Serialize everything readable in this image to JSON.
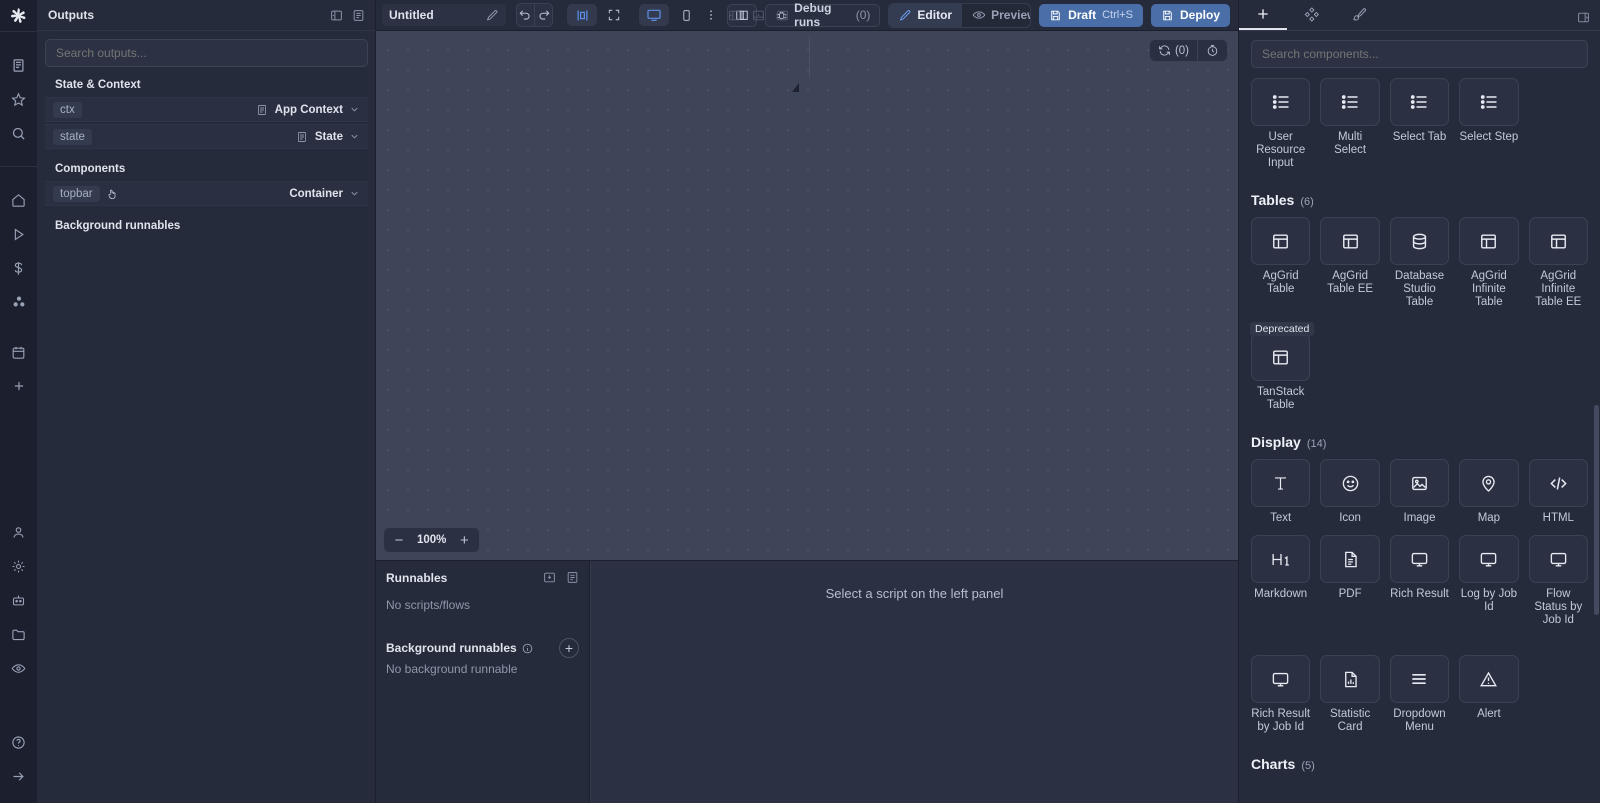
{
  "rail": {
    "logo": "windmill-logo",
    "groups": [
      [
        {
          "name": "runs-icon",
          "label": "Runs"
        },
        {
          "name": "star-icon",
          "label": "Favorites"
        },
        {
          "name": "search-icon",
          "label": "Search"
        }
      ],
      [
        {
          "name": "home-icon",
          "label": "Home"
        },
        {
          "name": "play-icon",
          "label": "Runs"
        },
        {
          "name": "dollar-icon",
          "label": "Usage"
        },
        {
          "name": "variables-icon",
          "label": "Resources"
        }
      ],
      [
        {
          "name": "calendar-icon",
          "label": "Schedules"
        },
        {
          "name": "plus-icon",
          "label": "New"
        }
      ],
      [
        {
          "name": "user-icon",
          "label": "Account"
        },
        {
          "name": "gear-icon",
          "label": "Settings"
        },
        {
          "name": "worker-icon",
          "label": "Workers"
        },
        {
          "name": "folder-icon",
          "label": "Folders"
        },
        {
          "name": "eye-icon",
          "label": "Audit logs"
        }
      ],
      [
        {
          "name": "help-icon",
          "label": "Help"
        },
        {
          "name": "arrow-right-icon",
          "label": "Expand"
        }
      ]
    ]
  },
  "topbar": {
    "app_title": "Untitled",
    "edit_icon": "pencil-icon",
    "undo_label": "undo-icon",
    "redo_label": "redo-icon",
    "center_align_icon": "align-center-icon",
    "fullscreen_icon": "fullscreen-icon",
    "desktop_icon": "desktop-icon",
    "mobile_icon": "mobile-icon",
    "panel_left_icon": "panel-left-icon",
    "panel_bottom_icon": "panel-bottom-icon",
    "panel_right_icon": "panel-right-icon",
    "more_icon": "more-vertical-icon",
    "book_icon": "book-icon",
    "debug_runs_label": "Debug runs",
    "debug_runs_count": "(0)",
    "editor_label": "Editor",
    "preview_label": "Preview",
    "draft_label": "Draft",
    "draft_shortcut": "Ctrl+S",
    "deploy_label": "Deploy"
  },
  "outputs_panel": {
    "title": "Outputs",
    "collapse_icon": "panel-collapse-icon",
    "list_icon": "list-icon",
    "search_placeholder": "Search outputs...",
    "sections": [
      {
        "label": "State & Context",
        "rows": [
          {
            "id": "ctx",
            "type": "App Context",
            "icon": "document-icon",
            "caret": "chevron-down-icon"
          },
          {
            "id": "state",
            "type": "State",
            "icon": "document-icon",
            "caret": "chevron-down-icon"
          }
        ]
      },
      {
        "label": "Components",
        "rows": [
          {
            "id": "topbar",
            "type": "Container",
            "icon": "",
            "caret": "chevron-down-icon",
            "cursor": "hand-pointer-icon"
          }
        ]
      }
    ],
    "background_runnables_label": "Background runnables"
  },
  "canvas": {
    "refresh_icon": "refresh-icon",
    "refresh_count": "(0)",
    "history_icon": "history-icon",
    "zoom_minus": "−",
    "zoom_value": "100%",
    "zoom_plus": "+"
  },
  "runnables_panel": {
    "title": "Runnables",
    "icon_1": "insert-icon",
    "icon_2": "list-icon",
    "empty_text": "No scripts/flows",
    "background_title": "Background runnables",
    "info_icon": "info-icon",
    "add_icon": "plus-icon",
    "background_empty": "No background runnable"
  },
  "script_pane": {
    "placeholder": "Select a script on the left panel"
  },
  "components_panel": {
    "tabs": [
      {
        "name": "tab-add",
        "icon": "plus-icon",
        "active": true
      },
      {
        "name": "tab-components",
        "icon": "grid-dots-icon",
        "active": false
      },
      {
        "name": "tab-styles",
        "icon": "brush-icon",
        "active": false
      }
    ],
    "collapse_icon": "panel-expand-icon",
    "search_placeholder": "Search components...",
    "top_items": [
      {
        "label": "User Resource Input",
        "icon": "list-icon"
      },
      {
        "label": "Multi Select",
        "icon": "list-icon"
      },
      {
        "label": "Select Tab",
        "icon": "list-icon"
      },
      {
        "label": "Select Step",
        "icon": "list-icon"
      }
    ],
    "categories": [
      {
        "name": "Tables",
        "count": "(6)",
        "items": [
          {
            "label": "AgGrid Table",
            "icon": "table-icon"
          },
          {
            "label": "AgGrid Table EE",
            "icon": "table-icon"
          },
          {
            "label": "Database Studio Table",
            "icon": "database-icon"
          },
          {
            "label": "AgGrid Infinite Table",
            "icon": "table-icon"
          },
          {
            "label": "AgGrid Infinite Table EE",
            "icon": "table-icon"
          },
          {
            "label": "TanStack Table",
            "icon": "table-icon",
            "badge": "Deprecated"
          }
        ]
      },
      {
        "name": "Display",
        "count": "(14)",
        "items": [
          {
            "label": "Text",
            "icon": "text-icon"
          },
          {
            "label": "Icon",
            "icon": "smiley-icon"
          },
          {
            "label": "Image",
            "icon": "image-icon"
          },
          {
            "label": "Map",
            "icon": "map-pin-icon"
          },
          {
            "label": "HTML",
            "icon": "code-icon"
          },
          {
            "label": "Markdown",
            "icon": "heading-icon"
          },
          {
            "label": "PDF",
            "icon": "file-text-icon"
          },
          {
            "label": "Rich Result",
            "icon": "monitor-icon"
          },
          {
            "label": "Log by Job Id",
            "icon": "monitor-icon"
          },
          {
            "label": "Flow Status by Job Id",
            "icon": "monitor-icon"
          },
          {
            "label": "Rich Result by Job Id",
            "icon": "monitor-icon"
          },
          {
            "label": "Statistic Card",
            "icon": "file-chart-icon"
          },
          {
            "label": "Dropdown Menu",
            "icon": "menu-icon"
          },
          {
            "label": "Alert",
            "icon": "alert-triangle-icon"
          }
        ]
      },
      {
        "name": "Charts",
        "count": "(5)",
        "items": []
      }
    ]
  }
}
